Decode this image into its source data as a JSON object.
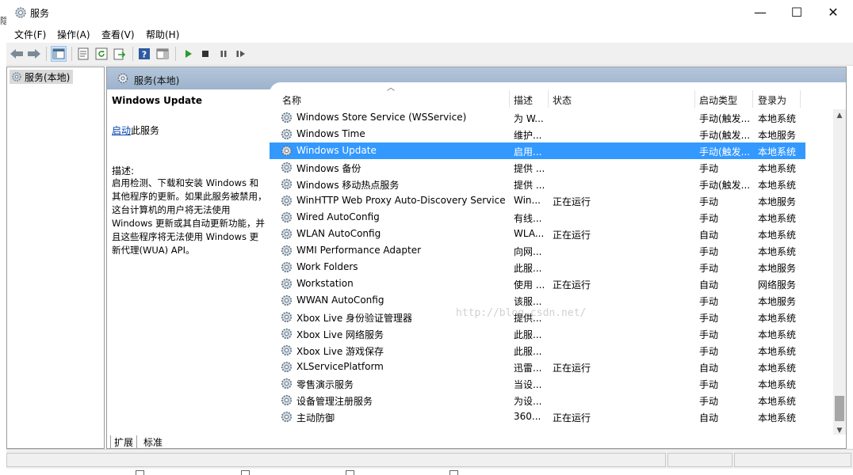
{
  "window": {
    "title": "服务",
    "controls": {
      "minimize": "—",
      "maximize": "☐",
      "close": "✕"
    }
  },
  "left_edge_glyph": "隐",
  "menu": [
    "文件(F)",
    "操作(A)",
    "查看(V)",
    "帮助(H)"
  ],
  "toolbar": {
    "icons": [
      "back-icon",
      "forward-icon",
      "console-tree-icon",
      "properties-icon",
      "refresh-icon",
      "export-icon",
      "help-icon",
      "show-hide-icon",
      "start-icon",
      "stop-icon",
      "pause-icon",
      "resume-icon"
    ]
  },
  "tree": {
    "item": "服务(本地)"
  },
  "main": {
    "header": "服务(本地)",
    "selected_service": "Windows Update",
    "start_link": "启动",
    "start_suffix": "此服务",
    "desc_label": "描述:",
    "desc_text": "启用检测、下载和安装 Windows 和其他程序的更新。如果此服务被禁用，这台计算机的用户将无法使用 Windows 更新或其自动更新功能，并且这些程序将无法使用 Windows 更新代理(WUA) API。",
    "watermark": "http://blog.csdn.net/"
  },
  "columns": [
    "名称",
    "描述",
    "状态",
    "启动类型",
    "登录为"
  ],
  "rows": [
    {
      "name": "Windows Store Service (WSService)",
      "desc": "为 W...",
      "status": "",
      "startup": "手动(触发...",
      "logon": "本地系统"
    },
    {
      "name": "Windows Time",
      "desc": "维护...",
      "status": "",
      "startup": "手动(触发...",
      "logon": "本地服务"
    },
    {
      "name": "Windows Update",
      "desc": "启用...",
      "status": "",
      "startup": "手动(触发...",
      "logon": "本地系统",
      "selected": true
    },
    {
      "name": "Windows 备份",
      "desc": "提供 ...",
      "status": "",
      "startup": "手动",
      "logon": "本地系统"
    },
    {
      "name": "Windows 移动热点服务",
      "desc": "提供 ...",
      "status": "",
      "startup": "手动(触发...",
      "logon": "本地系统"
    },
    {
      "name": "WinHTTP Web Proxy Auto-Discovery Service",
      "desc": "Win...",
      "status": "正在运行",
      "startup": "手动",
      "logon": "本地服务"
    },
    {
      "name": "Wired AutoConfig",
      "desc": "有线...",
      "status": "",
      "startup": "手动",
      "logon": "本地系统"
    },
    {
      "name": "WLAN AutoConfig",
      "desc": "WLA...",
      "status": "正在运行",
      "startup": "自动",
      "logon": "本地系统"
    },
    {
      "name": "WMI Performance Adapter",
      "desc": "向网...",
      "status": "",
      "startup": "手动",
      "logon": "本地系统"
    },
    {
      "name": "Work Folders",
      "desc": "此服...",
      "status": "",
      "startup": "手动",
      "logon": "本地服务"
    },
    {
      "name": "Workstation",
      "desc": "使用 ...",
      "status": "正在运行",
      "startup": "自动",
      "logon": "网络服务"
    },
    {
      "name": "WWAN AutoConfig",
      "desc": "该服...",
      "status": "",
      "startup": "手动",
      "logon": "本地服务"
    },
    {
      "name": "Xbox Live 身份验证管理器",
      "desc": "提供...",
      "status": "",
      "startup": "手动",
      "logon": "本地系统"
    },
    {
      "name": "Xbox Live 网络服务",
      "desc": "此服...",
      "status": "",
      "startup": "手动",
      "logon": "本地系统"
    },
    {
      "name": "Xbox Live 游戏保存",
      "desc": "此服...",
      "status": "",
      "startup": "手动",
      "logon": "本地系统"
    },
    {
      "name": "XLServicePlatform",
      "desc": "迅雷...",
      "status": "正在运行",
      "startup": "自动",
      "logon": "本地系统"
    },
    {
      "name": "零售演示服务",
      "desc": "当设...",
      "status": "",
      "startup": "手动",
      "logon": "本地系统"
    },
    {
      "name": "设备管理注册服务",
      "desc": "为设...",
      "status": "",
      "startup": "手动",
      "logon": "本地系统"
    },
    {
      "name": "主动防御",
      "desc": "360...",
      "status": "正在运行",
      "startup": "自动",
      "logon": "本地系统"
    }
  ],
  "tabs": [
    "扩展",
    "标准"
  ],
  "colors": {
    "selection": "#3399ff",
    "header": "#9db3cc",
    "link": "#0645ad"
  }
}
